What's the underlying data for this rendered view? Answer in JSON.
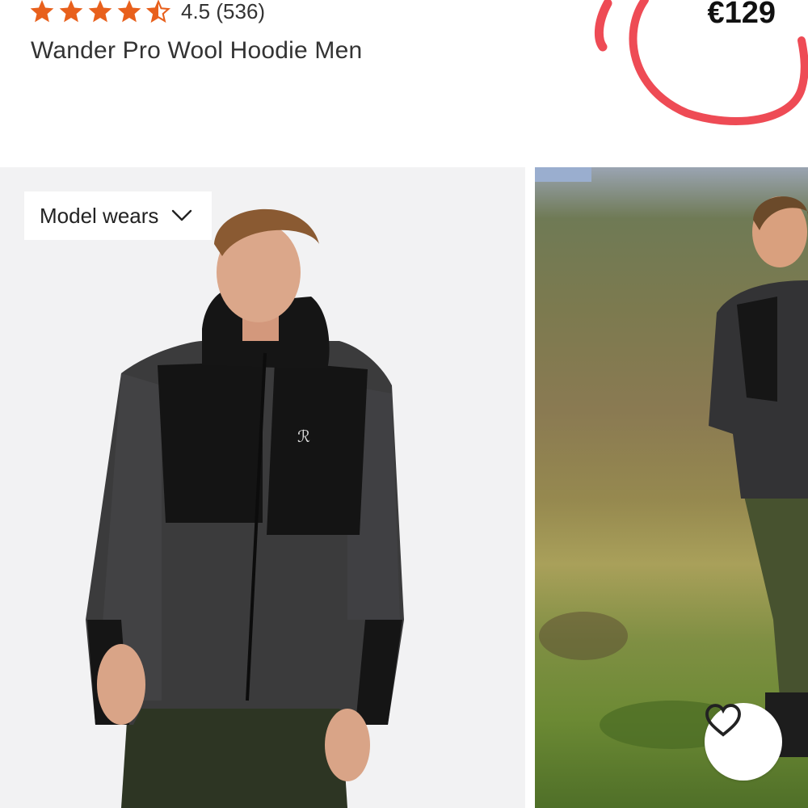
{
  "product": {
    "rating_value": "4.5",
    "rating_count": "(536)",
    "rating_stars": 4.5,
    "title": "Wander Pro Wool Hoodie Men",
    "price": "€129"
  },
  "gallery": {
    "model_wears_label": "Model wears",
    "icons": [
      "star-icon",
      "chevron-down-icon",
      "heart-icon"
    ]
  },
  "colors": {
    "star": "#e8601c",
    "annotation": "#ee4b55"
  }
}
